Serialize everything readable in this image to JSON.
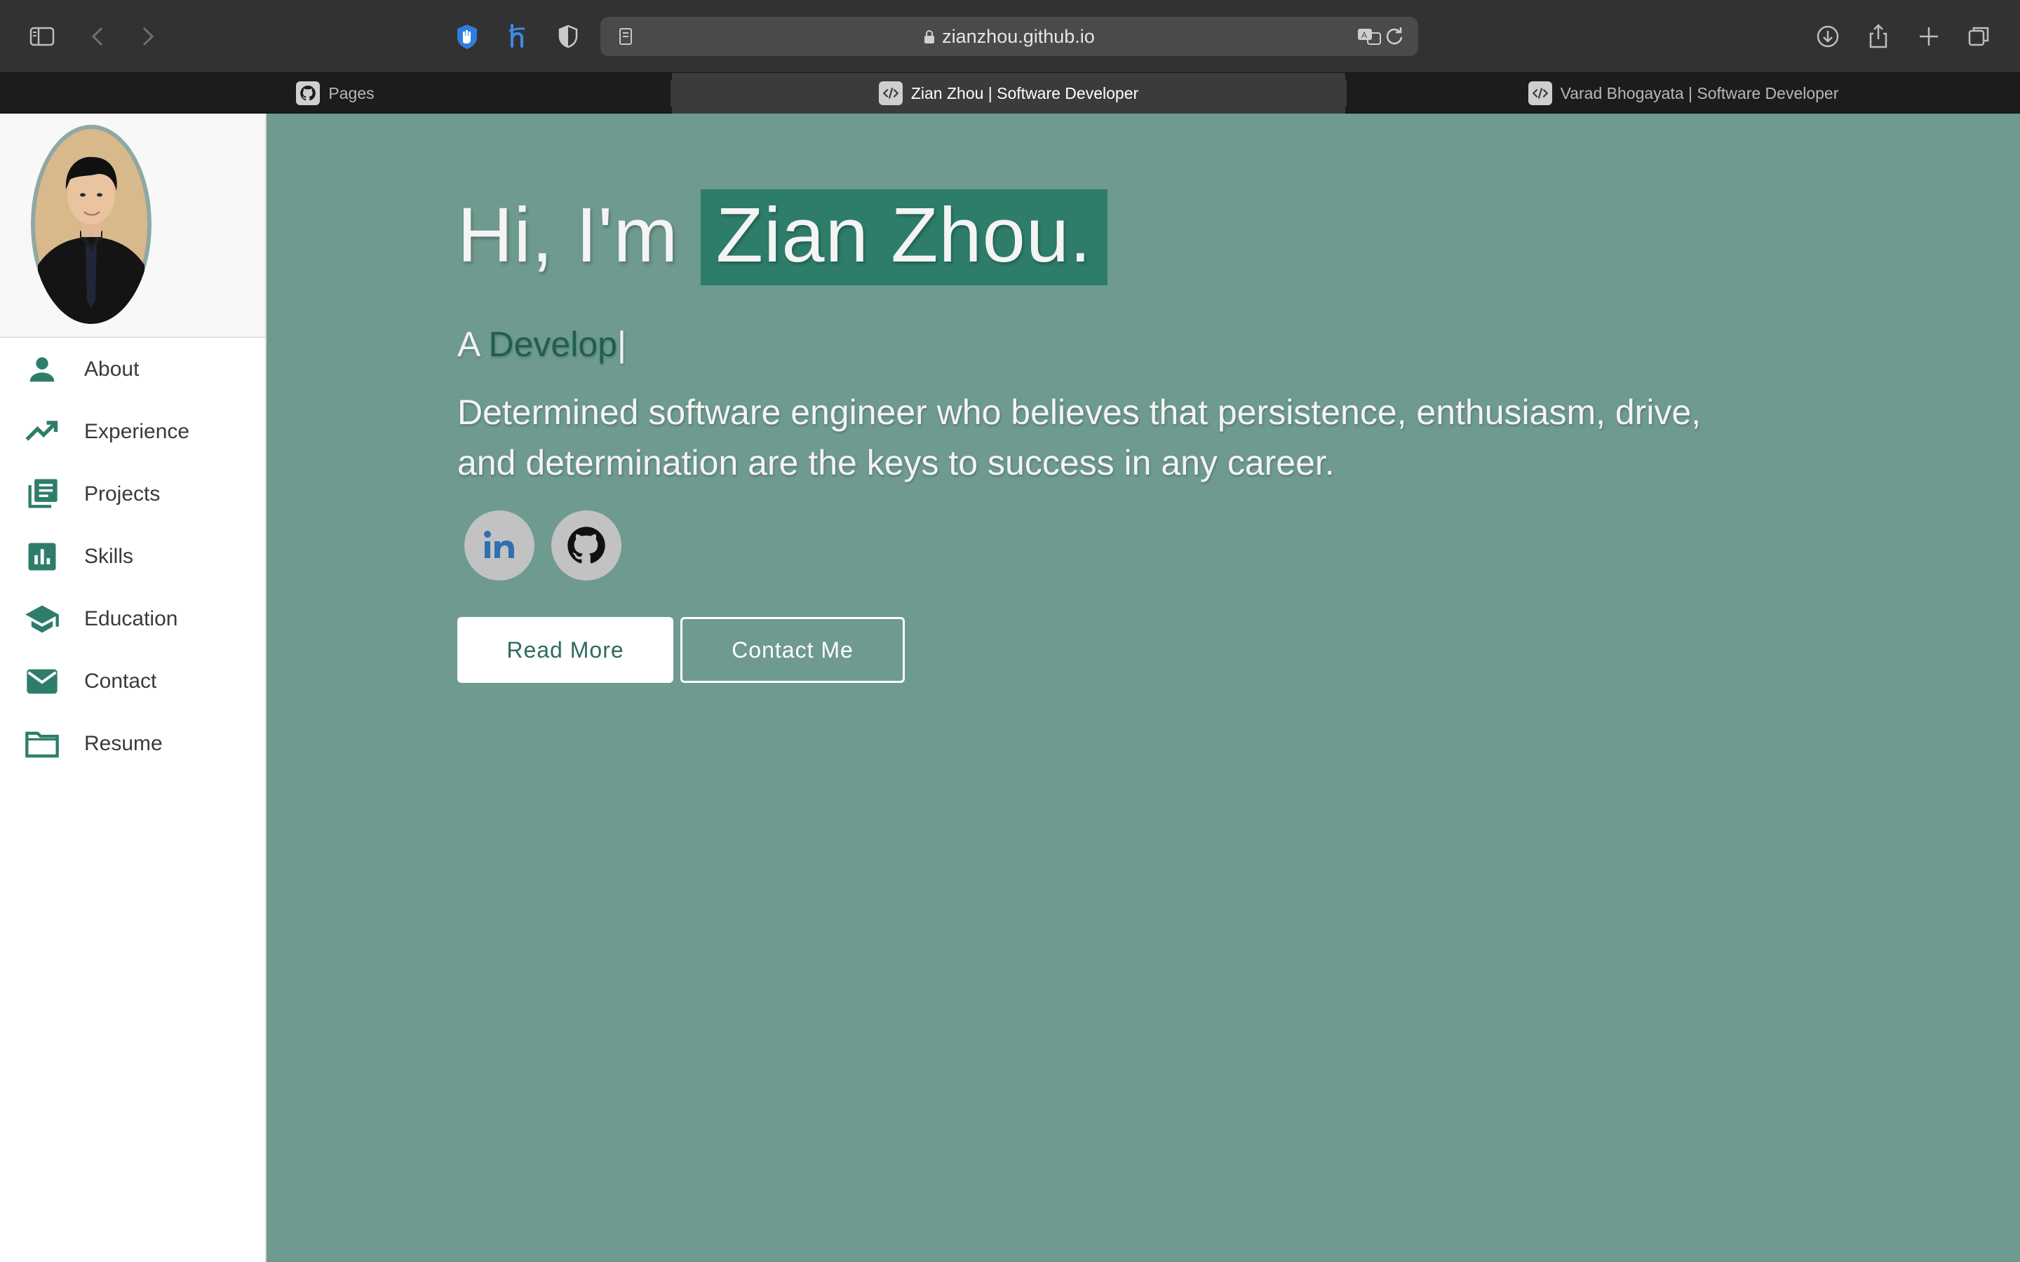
{
  "browser": {
    "url": "zianzhou.github.io",
    "tabs": [
      {
        "title": "Pages",
        "active": false
      },
      {
        "title": "Zian Zhou | Software Developer",
        "active": true
      },
      {
        "title": "Varad Bhogayata | Software Developer",
        "active": false
      }
    ]
  },
  "sidebar": {
    "items": [
      {
        "label": "About",
        "icon": "person-icon"
      },
      {
        "label": "Experience",
        "icon": "trending-up-icon"
      },
      {
        "label": "Projects",
        "icon": "library-books-icon"
      },
      {
        "label": "Skills",
        "icon": "bar-chart-icon"
      },
      {
        "label": "Education",
        "icon": "school-icon"
      },
      {
        "label": "Contact",
        "icon": "mail-icon"
      },
      {
        "label": "Resume",
        "icon": "folder-icon"
      }
    ]
  },
  "hero": {
    "greeting": "Hi, I'm ",
    "name": "Zian Zhou.",
    "typed_prefix": "A ",
    "typed_word": "Develop",
    "typed_cursor": "|",
    "tagline": "Determined software engineer who believes that persistence, enthusiasm, drive, and determination are the keys to success in any career.",
    "social": [
      "linkedin-icon",
      "github-icon"
    ],
    "read_more_label": "Read More",
    "contact_label": "Contact Me"
  },
  "colors": {
    "accent": "#2e7d6b",
    "main_bg": "#6e9a8f",
    "typed_word": "#1f5e52"
  }
}
